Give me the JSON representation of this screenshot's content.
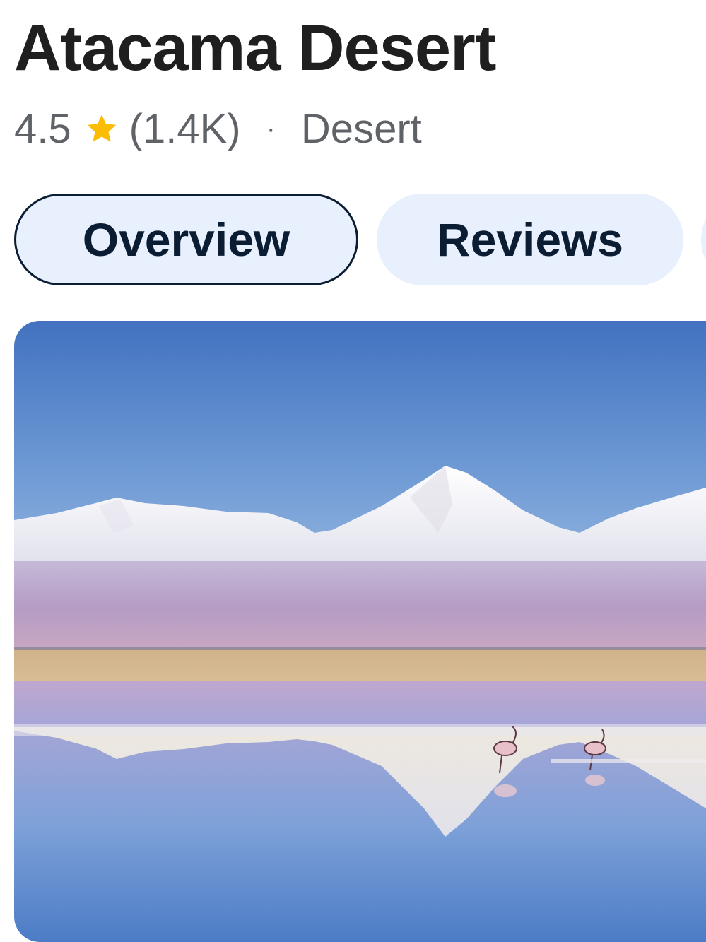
{
  "place": {
    "title": "Atacama Desert",
    "rating": "4.5",
    "review_count": "(1.4K)",
    "separator": "·",
    "category": "Desert"
  },
  "tabs": [
    {
      "label": "Overview",
      "active": true
    },
    {
      "label": "Reviews",
      "active": false
    },
    {
      "label": "",
      "active": false
    }
  ],
  "icons": {
    "rating_star": "star-icon"
  },
  "colors": {
    "star": "#fbbc04",
    "tab_bg": "#e8effd",
    "tab_text": "#0b1d33",
    "title": "#1f1f1f",
    "meta": "#5f6368"
  },
  "photo": {
    "subject": "landscape-photo"
  }
}
